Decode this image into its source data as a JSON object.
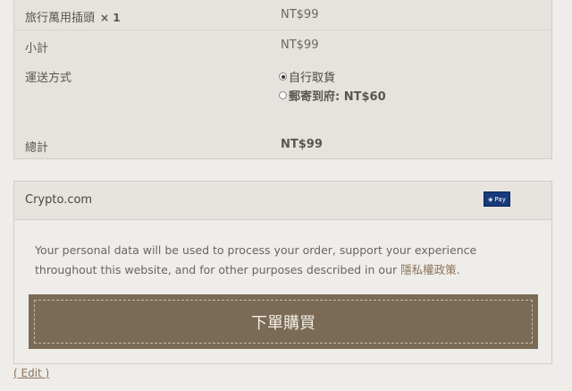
{
  "summary": {
    "item": {
      "name": "旅行萬用插頭",
      "qty": "× 1",
      "price": "NT$99"
    },
    "subtotal": {
      "label": "小計",
      "value": "NT$99"
    },
    "shipping": {
      "label": "運送方式",
      "options": [
        {
          "label": "自行取貨",
          "selected": true
        },
        {
          "label": "郵寄到府: NT$60",
          "selected": false
        }
      ]
    },
    "total": {
      "label": "總計",
      "value": "NT$99"
    }
  },
  "payment": {
    "method": "Crypto.com",
    "badge": "Pay",
    "privacy_text": "Your personal data will be used to process your order, support your experience throughout this website, and for other purposes described in our ",
    "privacy_link": "隱私權政策",
    "privacy_end": ".",
    "place_order": "下單購買"
  },
  "edit": "( Edit )"
}
